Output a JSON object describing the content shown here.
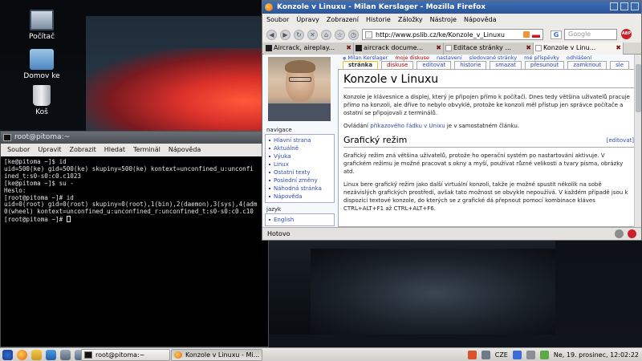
{
  "desktop": {
    "icons": [
      {
        "label": "Počítač"
      },
      {
        "label": "Domov ke"
      },
      {
        "label": "Koš"
      }
    ]
  },
  "terminal": {
    "title": "root@pitoma:~",
    "menu": [
      "Soubor",
      "Upravit",
      "Zobrazit",
      "Hledat",
      "Terminál",
      "Nápověda"
    ],
    "lines": [
      "[ke@pitoma ~]$ id",
      "uid=500(ke) gid=500(ke) skupiny=500(ke) kontext=unconfined_u:unconfi",
      "ined_t:s0-s0:c0.c1023",
      "[ke@pitoma ~]$ su -",
      "Heslo:",
      "[root@pitoma ~]# id",
      "uid=0(root) gid=0(root) skupiny=0(root),1(bin),2(daemon),3(sys),4(adm",
      "0(wheel) kontext=unconfined_u:unconfined_r:unconfined_t:s0-s0:c0.c10",
      "[root@pitoma ~]# "
    ]
  },
  "firefox": {
    "title": "Konzole v Linuxu - Milan Kerslager - Mozilla Firefox",
    "menu": [
      "Soubor",
      "Úpravy",
      "Zobrazení",
      "Historie",
      "Záložky",
      "Nástroje",
      "Nápověda"
    ],
    "url": "http://www.pslib.cz/ke/Konzole_v_Linuxu",
    "search_placeholder": "Google",
    "abp_label": "ABP",
    "tabs": [
      {
        "label": "Aircrack, aireplay..."
      },
      {
        "label": "aircrack docume..."
      },
      {
        "label": "Editace stránky ..."
      },
      {
        "label": "Konzole v Linu..."
      }
    ],
    "status": "Hotovo"
  },
  "wiki": {
    "user_links": [
      "Milan Kerslager",
      "moje diskuse",
      "nastavení",
      "sledované stránky",
      "mé příspěvky",
      "odhlášení"
    ],
    "page_tabs": [
      "stránka",
      "diskuse",
      "editovat",
      "historie",
      "smazat",
      "přesunout",
      "zamknout",
      "sle"
    ],
    "nav_title": "navigace",
    "nav_items": [
      "Hlavní strana",
      "Aktuálně",
      "Výuka",
      "Linux",
      "Ostatní texty",
      "Poslední změny",
      "Náhodná stránka",
      "Nápověda"
    ],
    "lang_title": "jazyk",
    "lang_items": [
      "English"
    ],
    "page_title": "Konzole v Linuxu",
    "intro": "Konzole je klávesnice a displej, který je připojen přímo k počítači. Dnes tedy většina uživatelů pracuje přímo na konzoli, ale dříve to nebylo obvyklé, protože ke konzoli měl přístup jen správce počítače a ostatní se připojovali z terminálů.",
    "control_prefix": "Ovládání ",
    "control_link": "příkazového řádku v Unixu",
    "control_suffix": " je v samostatném článku.",
    "section_title": "Grafický režim",
    "section_edit": "[editovat]",
    "para1": "Grafický režim zná většina uživatelů, protože ho operační systém po nastartování aktivuje. V grafickém režimu je možné pracovat s okny a myší, používat různé velikosti a tvary písma, obrázky atd.",
    "para2": "Linux bere grafický režim jako další virtuální konzoli, takže je možné spustit několik na sobě nezávislých grafických prostředí, avšak tato možnost se obvykle nepoužívá. V každém případě jsou k dispozici textové konzole, do kterých se z grafické dá přepnout pomocí kombinace kláves CTRL+ALT+F1 až CTRL+ALT+F6."
  },
  "taskbar": {
    "tasks": [
      {
        "label": "root@pitoma:~"
      },
      {
        "label": "Konzole v Linuxu - Mi..."
      }
    ],
    "keyboard": "CZE",
    "clock": "Ne, 19. prosinec, 12:02:22"
  }
}
